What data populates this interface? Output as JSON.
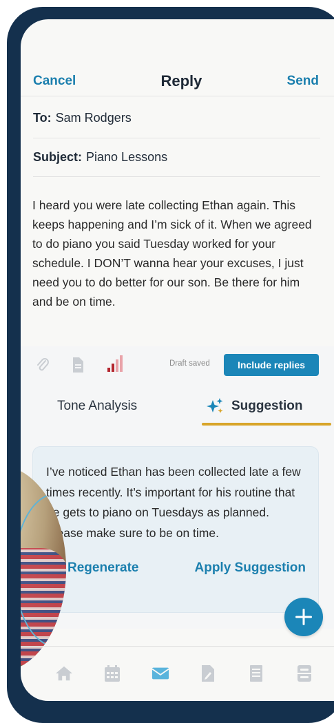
{
  "header": {
    "cancel_label": "Cancel",
    "title": "Reply",
    "send_label": "Send"
  },
  "to": {
    "label": "To:",
    "value": "Sam Rodgers"
  },
  "subject": {
    "label": "Subject:",
    "value": "Piano Lessons"
  },
  "message": {
    "body": "I heard you were late collecting Ethan again. This keeps happening and I’m sick of it. When we agreed to do piano you said Tuesday worked for your schedule. I DON’T wanna hear your excuses, I just need you to do better for our son. Be there for him and be on time."
  },
  "toolbar": {
    "icons": [
      "paperclip-icon",
      "document-icon",
      "tone-bars-icon"
    ],
    "draft_status": "Draft saved",
    "include_replies_label": "Include replies"
  },
  "tabs": {
    "tone_analysis_label": "Tone Analysis",
    "suggestion_label": "Suggestion",
    "active": "suggestion"
  },
  "suggestion": {
    "text": "I’ve noticed Ethan has been collected late a few times recently. It’s important for his routine that he gets to piano on Tuesdays as planned. Please make sure to be on time.",
    "regenerate_label": "Regenerate",
    "apply_label": "Apply Suggestion"
  },
  "bottom_nav": {
    "items": [
      "home-icon",
      "calendar-icon",
      "mail-icon",
      "file-edit-icon",
      "notes-icon",
      "contacts-icon"
    ],
    "active": "mail-icon"
  },
  "colors": {
    "accent": "#1b86b8",
    "link": "#1b7fae",
    "underline": "#d8a52a",
    "frame": "#14304d",
    "suggestion_bg": "#e8f0f5"
  }
}
